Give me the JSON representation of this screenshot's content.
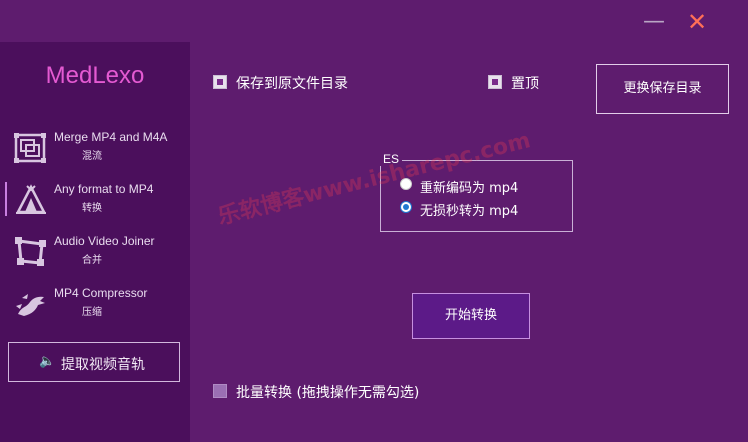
{
  "window": {
    "minimize_glyph": "—",
    "close_glyph": "✕"
  },
  "sidebar": {
    "logo": "MedLexo",
    "items": [
      {
        "title": "Merge MP4 and M4A",
        "sub": "混流",
        "icon": "merge-frames-icon"
      },
      {
        "title": "Any format to MP4",
        "sub": "转换",
        "icon": "tent-icon"
      },
      {
        "title": "Audio Video Joiner",
        "sub": "合并",
        "icon": "crop-frame-icon"
      },
      {
        "title": "MP4 Compressor",
        "sub": "压缩",
        "icon": "dragon-icon"
      }
    ],
    "audio_button": "提取视频音轨"
  },
  "main": {
    "save_to_source": "保存到原文件目录",
    "pin_top": "置顶",
    "change_dir_button": "更换保存目录",
    "es_group": {
      "title": "ES",
      "options": [
        "重新编码为 mp4",
        "无损秒转为 mp4"
      ],
      "selected_index": 1
    },
    "start_button": "开始转换",
    "batch_label": "批量转换  (拖拽操作无需勾选)"
  },
  "watermark": "乐软博客www.isharepc.com",
  "colors": {
    "bg": "#5e1c6e",
    "sidebar": "#4b0f5c",
    "logo": "#e45ad2",
    "close": "#ff6f57",
    "radio": "#1f78d1"
  }
}
